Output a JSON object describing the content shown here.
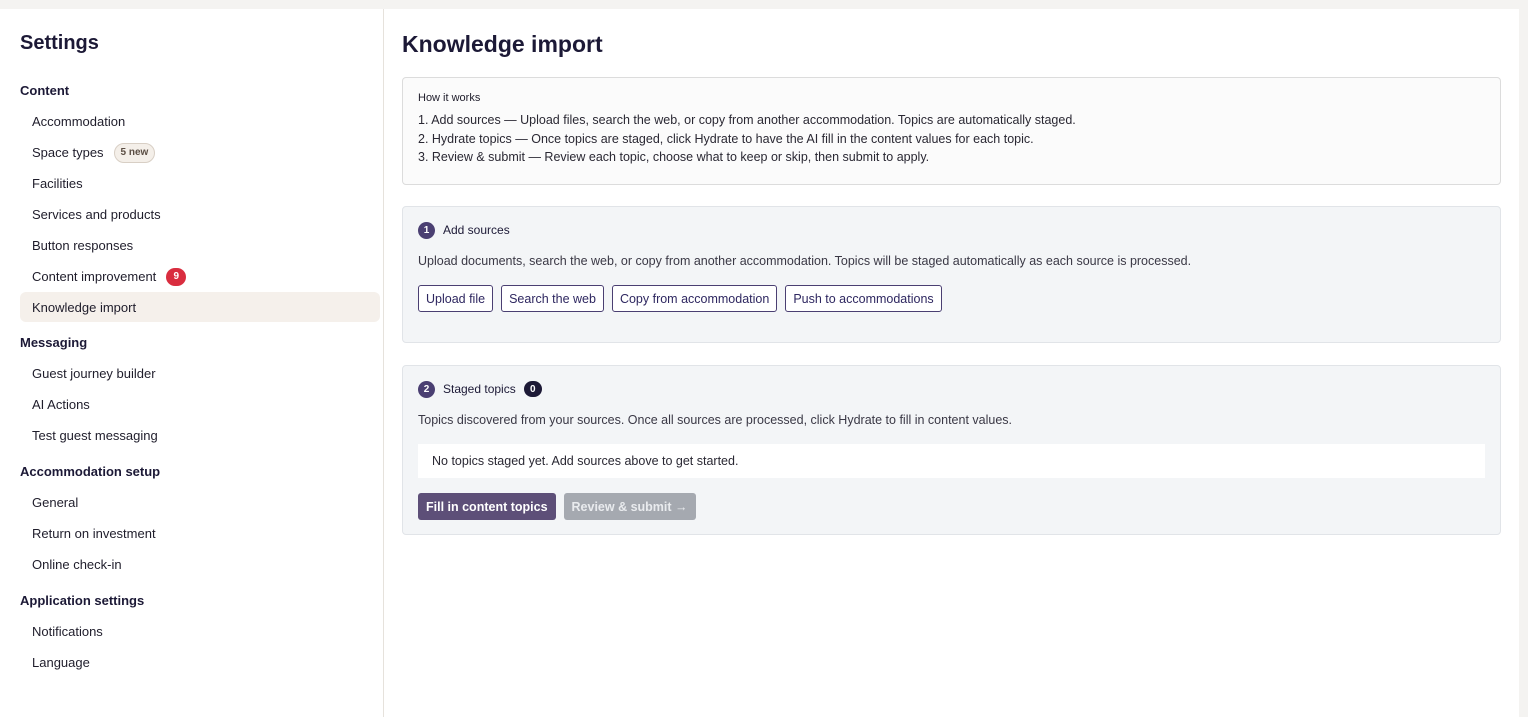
{
  "sidebar": {
    "title": "Settings",
    "sections": [
      {
        "title": "Content",
        "items": [
          {
            "label": "Accommodation"
          },
          {
            "label": "Space types",
            "badge": "5 new"
          },
          {
            "label": "Facilities"
          },
          {
            "label": "Services and products"
          },
          {
            "label": "Button responses"
          },
          {
            "label": "Content improvement",
            "count": "9"
          },
          {
            "label": "Knowledge import",
            "active": true
          }
        ]
      },
      {
        "title": "Messaging",
        "items": [
          {
            "label": "Guest journey builder"
          },
          {
            "label": "AI Actions"
          },
          {
            "label": "Test guest messaging"
          }
        ]
      },
      {
        "title": "Accommodation setup",
        "items": [
          {
            "label": "General"
          },
          {
            "label": "Return on investment"
          },
          {
            "label": "Online check-in"
          }
        ]
      },
      {
        "title": "Application settings",
        "items": [
          {
            "label": "Notifications"
          },
          {
            "label": "Language"
          }
        ]
      }
    ]
  },
  "main": {
    "title": "Knowledge import",
    "how": {
      "label": "How it works",
      "steps": [
        "1. Add sources — Upload files, search the web, or copy from another accommodation. Topics are automatically staged.",
        "2. Hydrate topics — Once topics are staged, click Hydrate to have the AI fill in the content values for each topic.",
        "3. Review & submit — Review each topic, choose what to keep or skip, then submit to apply."
      ]
    },
    "add_sources": {
      "number": "1",
      "title": "Add sources",
      "description": "Upload documents, search the web, or copy from another accommodation. Topics will be staged automatically as each source is processed.",
      "buttons": [
        "Upload file",
        "Search the web",
        "Copy from accommodation",
        "Push to accommodations"
      ]
    },
    "staged": {
      "number": "2",
      "title": "Staged topics",
      "count": "0",
      "description": "Topics discovered from your sources. Once all sources are processed, click Hydrate to fill in content values.",
      "empty": "No topics staged yet. Add sources above to get started.",
      "fill_button": "Fill in content topics",
      "review_button": "Review & submit →"
    }
  },
  "colors": {
    "accent": "#4a3f72",
    "badge_red": "#d92d3f",
    "active_bg": "#f5f0eb"
  }
}
